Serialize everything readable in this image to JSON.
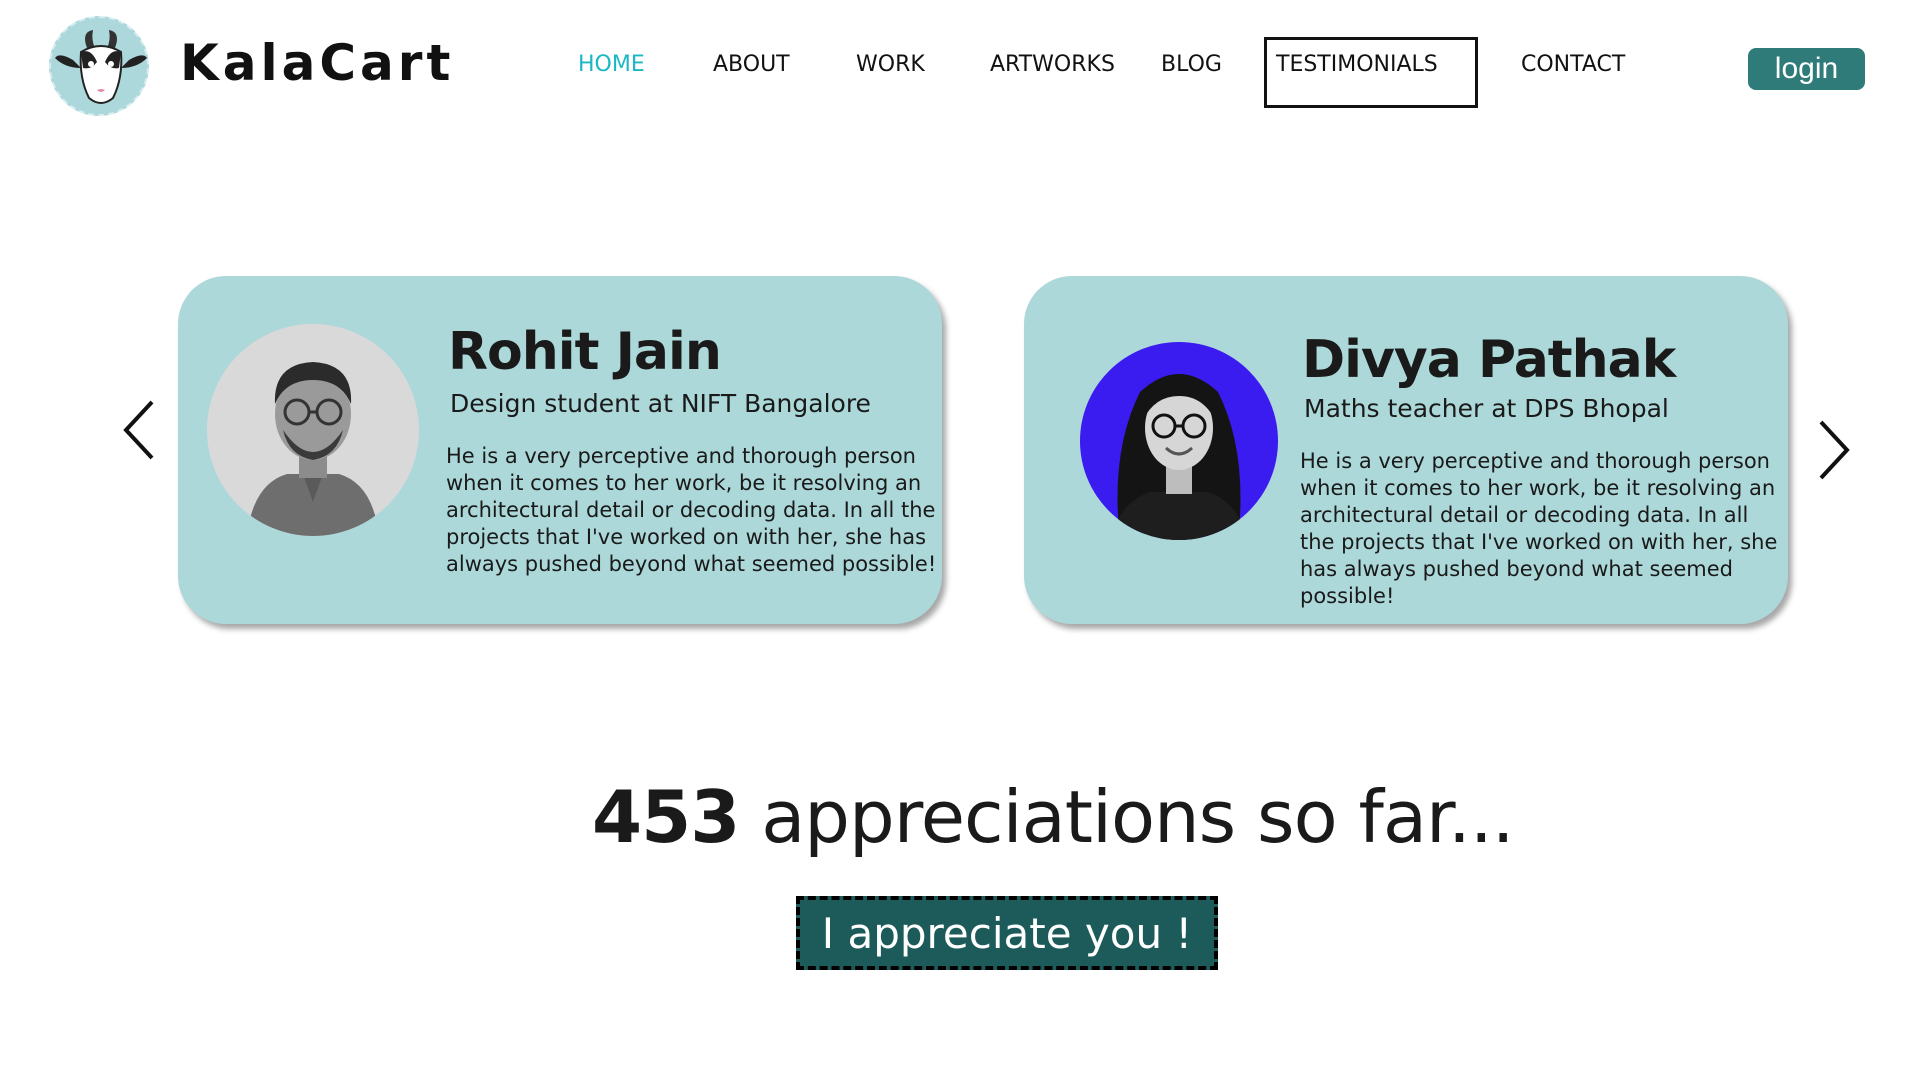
{
  "header": {
    "brand": "KalaCart",
    "logo_icon": "goat-logo-icon",
    "nav": [
      {
        "label": "HOME",
        "active": true
      },
      {
        "label": "ABOUT",
        "active": false
      },
      {
        "label": "WORK",
        "active": false
      },
      {
        "label": "ARTWORKS",
        "active": false
      },
      {
        "label": "BLOG",
        "active": false
      },
      {
        "label": "TESTIMONIALS",
        "active": false,
        "boxed": true
      },
      {
        "label": "CONTACT",
        "active": false
      }
    ],
    "login_label": "login"
  },
  "testimonials": [
    {
      "name": "Rohit Jain",
      "role": "Design student at NIFT Bangalore",
      "text": "He is a very perceptive and thorough person when it comes to her work, be it resolving an architectural detail or decoding data. In all the projects that I've worked on with her, she has always pushed beyond what seemed possible!"
    },
    {
      "name": "Divya Pathak",
      "role": "Maths teacher at DPS Bhopal",
      "text": "He is a very perceptive and thorough person when it comes to her work, be it resolving an architectural detail or decoding data. In all the projects that I've worked on with her, she has always pushed beyond what seemed possible!"
    }
  ],
  "carousel": {
    "prev_icon": "chevron-left-icon",
    "next_icon": "chevron-right-icon"
  },
  "appreciation": {
    "count": "453",
    "suffix": "appreciations so far...",
    "button_label": "I appreciate you !"
  },
  "colors": {
    "accent": "#1bb8c4",
    "card_bg": "#acd8d9",
    "login_bg": "#2e7b7a",
    "button_bg": "#1d5b5a",
    "avatar_2_bg": "#3a1cf0"
  }
}
